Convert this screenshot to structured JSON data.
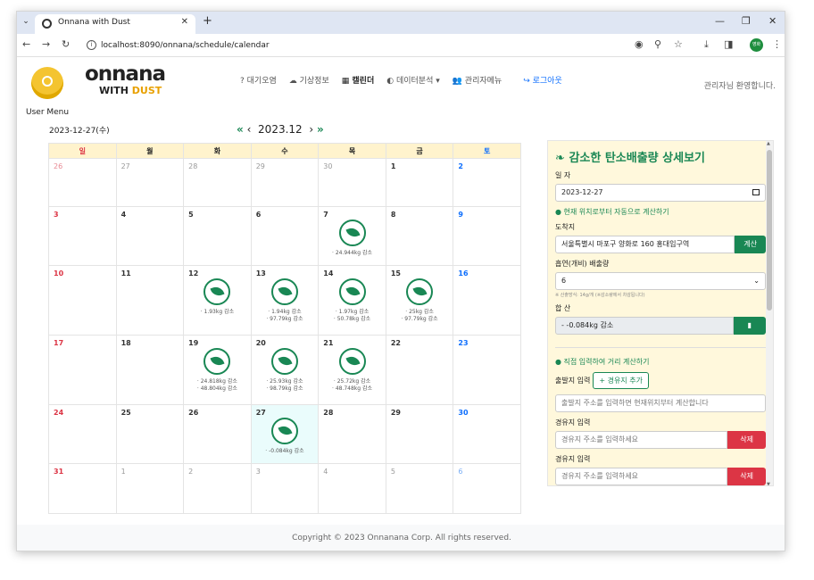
{
  "browser": {
    "tab_title": "Onnana with Dust",
    "url": "localhost:8090/onnana/schedule/calendar",
    "profile_label": "영화"
  },
  "header": {
    "logo_main": "onnana",
    "logo_with": "WITH",
    "logo_dust": "DUST",
    "user_menu": "User Menu",
    "nav": [
      "? 대기오염",
      "☁ 기상정보",
      "▦ 캘린더",
      "◐ 데이터분석 ▾",
      "👥 관리자메뉴"
    ],
    "logout": "↪ 로그아웃",
    "welcome": "관리자님 환영합니다."
  },
  "calendar": {
    "selected_date": "2023-12-27(수)",
    "month_label": "2023.12",
    "nav_prev2": "«",
    "nav_prev": "‹",
    "nav_next": "›",
    "nav_next2": "»",
    "weekdays": [
      "일",
      "월",
      "화",
      "수",
      "목",
      "금",
      "토"
    ],
    "weeks": [
      [
        {
          "d": "26",
          "other": true
        },
        {
          "d": "27",
          "other": true
        },
        {
          "d": "28",
          "other": true
        },
        {
          "d": "29",
          "other": true
        },
        {
          "d": "30",
          "other": true
        },
        {
          "d": "1"
        },
        {
          "d": "2"
        }
      ],
      [
        {
          "d": "3"
        },
        {
          "d": "4"
        },
        {
          "d": "5"
        },
        {
          "d": "6"
        },
        {
          "d": "7",
          "leaf": true,
          "notes": [
            "· 24.944kg 감소"
          ]
        },
        {
          "d": "8"
        },
        {
          "d": "9"
        }
      ],
      [
        {
          "d": "10"
        },
        {
          "d": "11"
        },
        {
          "d": "12",
          "leaf": true,
          "notes": [
            "· 1.93kg 감소"
          ]
        },
        {
          "d": "13",
          "leaf": true,
          "notes": [
            "· 1.94kg 감소",
            "· 97.79kg 감소"
          ]
        },
        {
          "d": "14",
          "leaf": true,
          "notes": [
            "· 1.97kg 감소",
            "· 50.78kg 감소"
          ]
        },
        {
          "d": "15",
          "leaf": true,
          "notes": [
            "· 25kg 감소",
            "· 97.79kg 감소"
          ]
        },
        {
          "d": "16"
        }
      ],
      [
        {
          "d": "17"
        },
        {
          "d": "18"
        },
        {
          "d": "19",
          "leaf": true,
          "notes": [
            "· 24.818kg 감소",
            "· 48.804kg 감소"
          ]
        },
        {
          "d": "20",
          "leaf": true,
          "notes": [
            "· 25.93kg 감소",
            "· 98.79kg 감소"
          ]
        },
        {
          "d": "21",
          "leaf": true,
          "notes": [
            "· 25.72kg 감소",
            "· 48.748kg 감소"
          ]
        },
        {
          "d": "22"
        },
        {
          "d": "23"
        }
      ],
      [
        {
          "d": "24"
        },
        {
          "d": "25"
        },
        {
          "d": "26"
        },
        {
          "d": "27",
          "today": true,
          "leaf": true,
          "notes": [
            "· -0.084kg 감소"
          ]
        },
        {
          "d": "28"
        },
        {
          "d": "29"
        },
        {
          "d": "30"
        }
      ],
      [
        {
          "d": "31"
        },
        {
          "d": "1",
          "other": true
        },
        {
          "d": "2",
          "other": true
        },
        {
          "d": "3",
          "other": true
        },
        {
          "d": "4",
          "other": true
        },
        {
          "d": "5",
          "other": true
        },
        {
          "d": "6",
          "other": true
        }
      ]
    ]
  },
  "panel": {
    "title": "감소한 탄소배출량 상세보기",
    "date_label": "일 자",
    "date_value": "2023-12-27",
    "auto_calc_label": "현재 위치로부터 자동으로 계산하기",
    "dest_label": "도착지",
    "dest_value": "서울특별시 마포구 양화로 160 홍대입구역",
    "calc_button": "계산",
    "smoke_label": "흡연(개비) 배출량",
    "smoke_value": "6",
    "smoke_note": "※ 산출방식: 14g/개 (※감소량에서 차감됩니다)",
    "sum_label": "합 산",
    "sum_value": "- -0.084kg 감소",
    "save_button_icon": "▮",
    "manual_label": "직접 입력하여 거리 계산하기",
    "origin_label": "출발지 입력",
    "add_waypoint": "+ 경유지 추가",
    "origin_placeholder": "출발지 주소를 입력하면 현재위치부터 계산합니다",
    "waypoint_label": "경유지 입력",
    "waypoint_placeholder": "경유지 주소를 입력하세요",
    "delete_button": "삭제"
  },
  "footer": {
    "copyright": "Copyright © 2023 Onnanana Corp. All rights reserved."
  },
  "colors": {
    "accent_green": "#198754",
    "danger": "#dc3545",
    "header_yellow": "#fff3cd",
    "panel_bg": "#fff8dc"
  }
}
